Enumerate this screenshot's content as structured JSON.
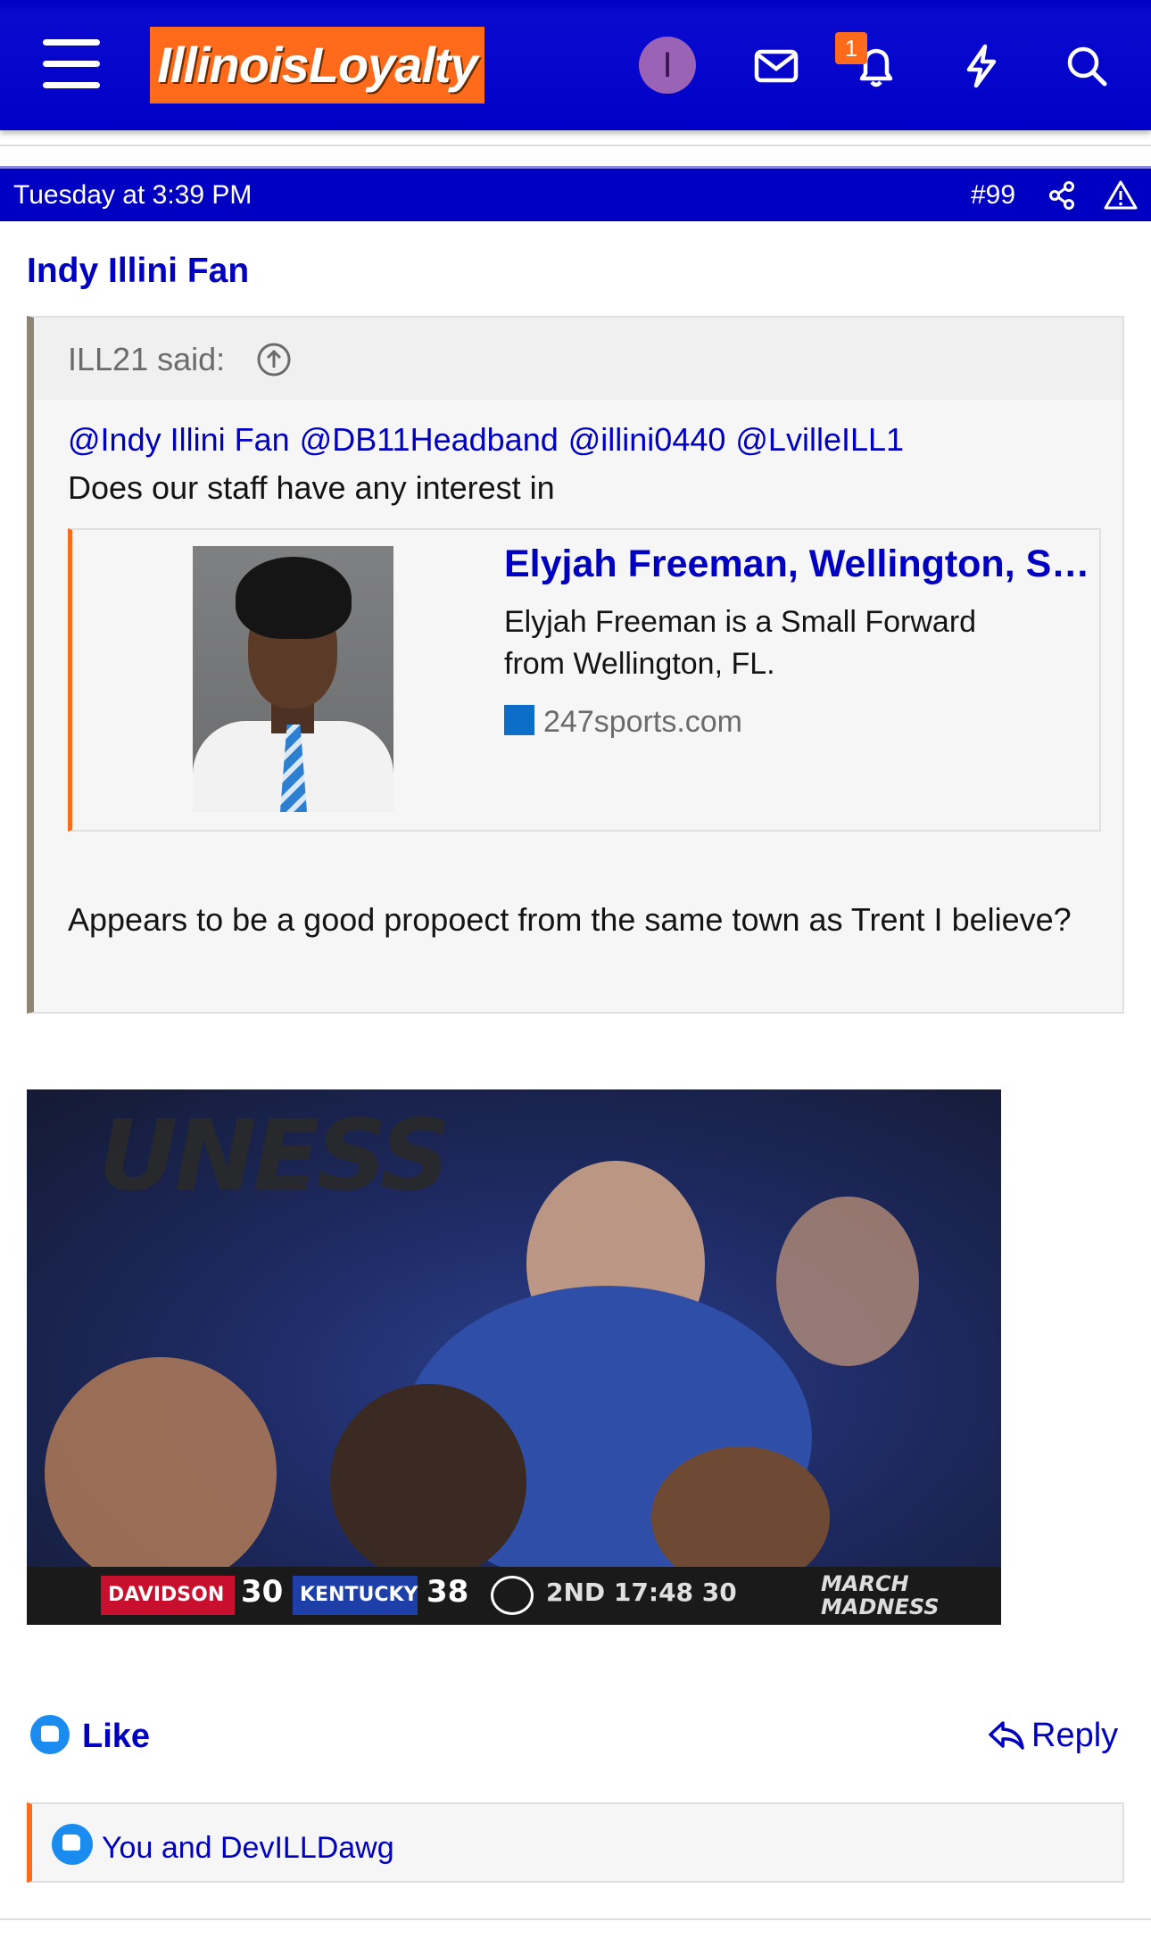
{
  "header": {
    "logo": "IllinoisLoyalty",
    "avatar_letter": "I",
    "notification_count": "1",
    "colors": {
      "brand_blue": "#0000c2",
      "accent_orange": "#ff6b1a",
      "avatar_purple": "#9a63b5"
    },
    "icons": [
      "menu-icon",
      "mail-icon",
      "bell-icon",
      "lightning-icon",
      "search-icon"
    ]
  },
  "post": {
    "timestamp": "Tuesday at 3:39 PM",
    "number": "#99",
    "author": "Indy Illini Fan"
  },
  "quote": {
    "said": "ILL21 said:",
    "mentions": [
      "@Indy Illini Fan",
      "@DB11Headband",
      "@illini0440",
      "@LvilleILL1"
    ],
    "line1": "Does our staff have any interest in",
    "embed": {
      "title": "Elyjah Freeman, Wellington, Small Forward",
      "description": "Elyjah Freeman is a Small Forward from Wellington, FL.",
      "source": "247sports.com"
    },
    "body": "Appears to be a good propoect from the same town as Trent I believe?"
  },
  "gif": {
    "banner": "UNESS",
    "team1": "DAVIDSON",
    "score1": "30",
    "team2": "KENTUCKY",
    "score2": "38",
    "clock": "2ND 17:48 30",
    "logo_text": "MARCH MADNESS"
  },
  "actions": {
    "like": "Like",
    "reply": "Reply",
    "reactions": "You and DevILLDawg"
  }
}
